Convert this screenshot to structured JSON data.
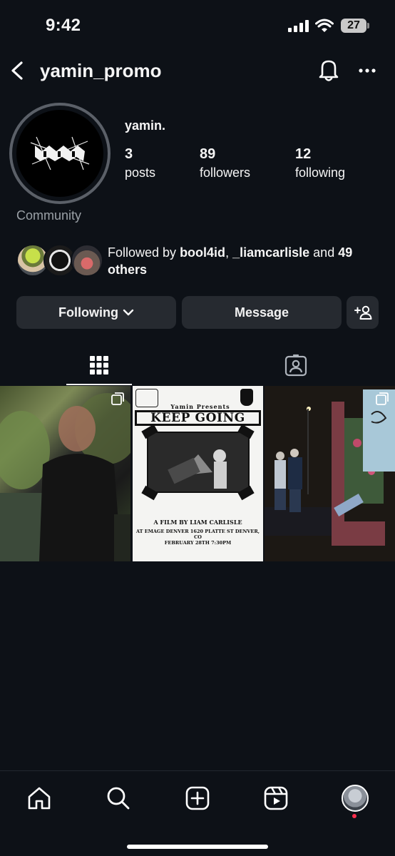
{
  "status_bar": {
    "time": "9:42",
    "battery": "27"
  },
  "header": {
    "username": "yamin_promo"
  },
  "profile": {
    "display_name": "yamin.",
    "category": "Community",
    "stats": {
      "posts": {
        "count": "3",
        "label": "posts"
      },
      "followers": {
        "count": "89",
        "label": "followers"
      },
      "following": {
        "count": "12",
        "label": "following"
      }
    },
    "followed_by": {
      "prefix": "Followed by ",
      "user1": "bool4id",
      "sep": ", ",
      "user2": "_liamcarlisle",
      "and": " and ",
      "others": "49 others"
    }
  },
  "actions": {
    "following": "Following",
    "message": "Message"
  },
  "tabs": [
    "posts-grid",
    "tagged"
  ],
  "posts": [
    {
      "kind": "photo"
    },
    {
      "kind": "poster",
      "presenter": "Yamin Presents",
      "title": "KEEP GOING",
      "credit": "A FILM BY LIAM CARLISLE",
      "venue": "AT EMAGE DENVER  1620 PLATTE ST DENVER, CO",
      "date": "FEBRUARY 28TH 7:30PM"
    },
    {
      "kind": "collage"
    }
  ],
  "bottom_nav": [
    "home",
    "search",
    "create",
    "reels",
    "profile"
  ],
  "colors": {
    "background": "#0d1117",
    "button": "#262a30",
    "notification_dot": "#ff2e4d"
  }
}
